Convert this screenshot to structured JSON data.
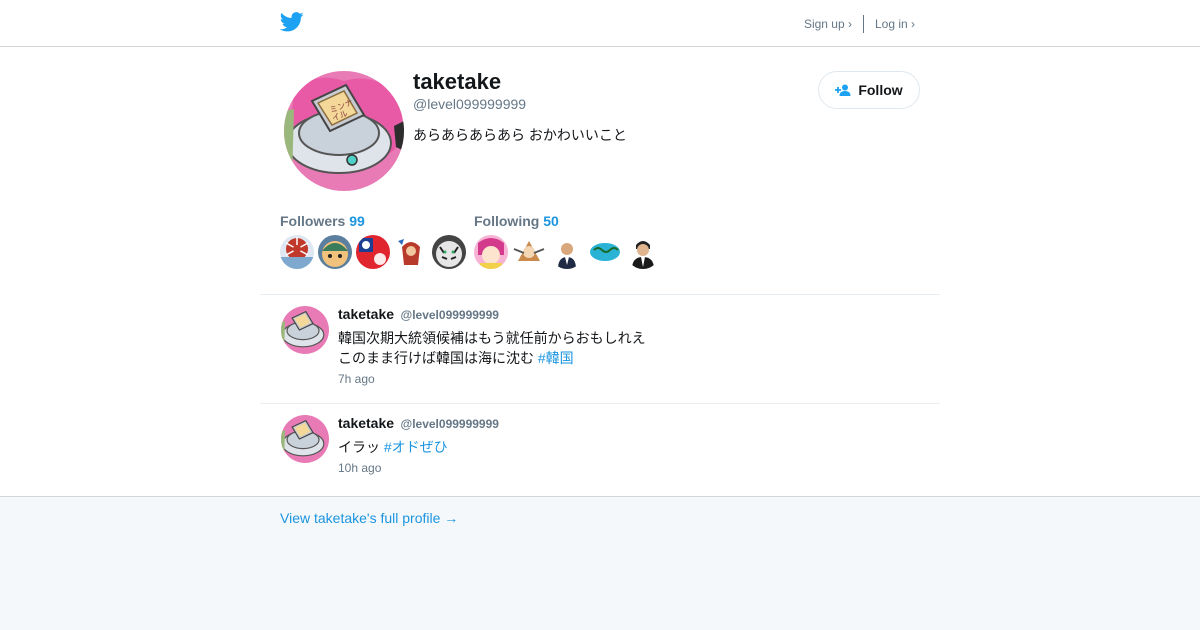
{
  "header": {
    "signup_label": "Sign up ›",
    "login_label": "Log in ›"
  },
  "profile": {
    "name": "taketake",
    "handle": "@level099999999",
    "bio": "あらあらあらあら おかわいいこと",
    "follow_label": "Follow",
    "followers_label": "Followers",
    "followers_count": "99",
    "following_label": "Following",
    "following_count": "50"
  },
  "tweets": [
    {
      "name": "taketake",
      "handle": "@level099999999",
      "line1": "韓国次期大統領候補はもう就任前からおもしれえ",
      "line2": "このまま行けば韓国は海に沈む",
      "hashtag": "#韓国",
      "time": "7h ago"
    },
    {
      "name": "taketake",
      "handle": "@level099999999",
      "line1": "イラッ",
      "hashtag": "#オドぜひ",
      "time": "10h ago"
    }
  ],
  "footer": {
    "full_profile_label": "View taketake's full profile →"
  },
  "colors": {
    "accent": "#1b95e0",
    "twitter_blue": "#1da1f2",
    "muted": "#657786"
  }
}
